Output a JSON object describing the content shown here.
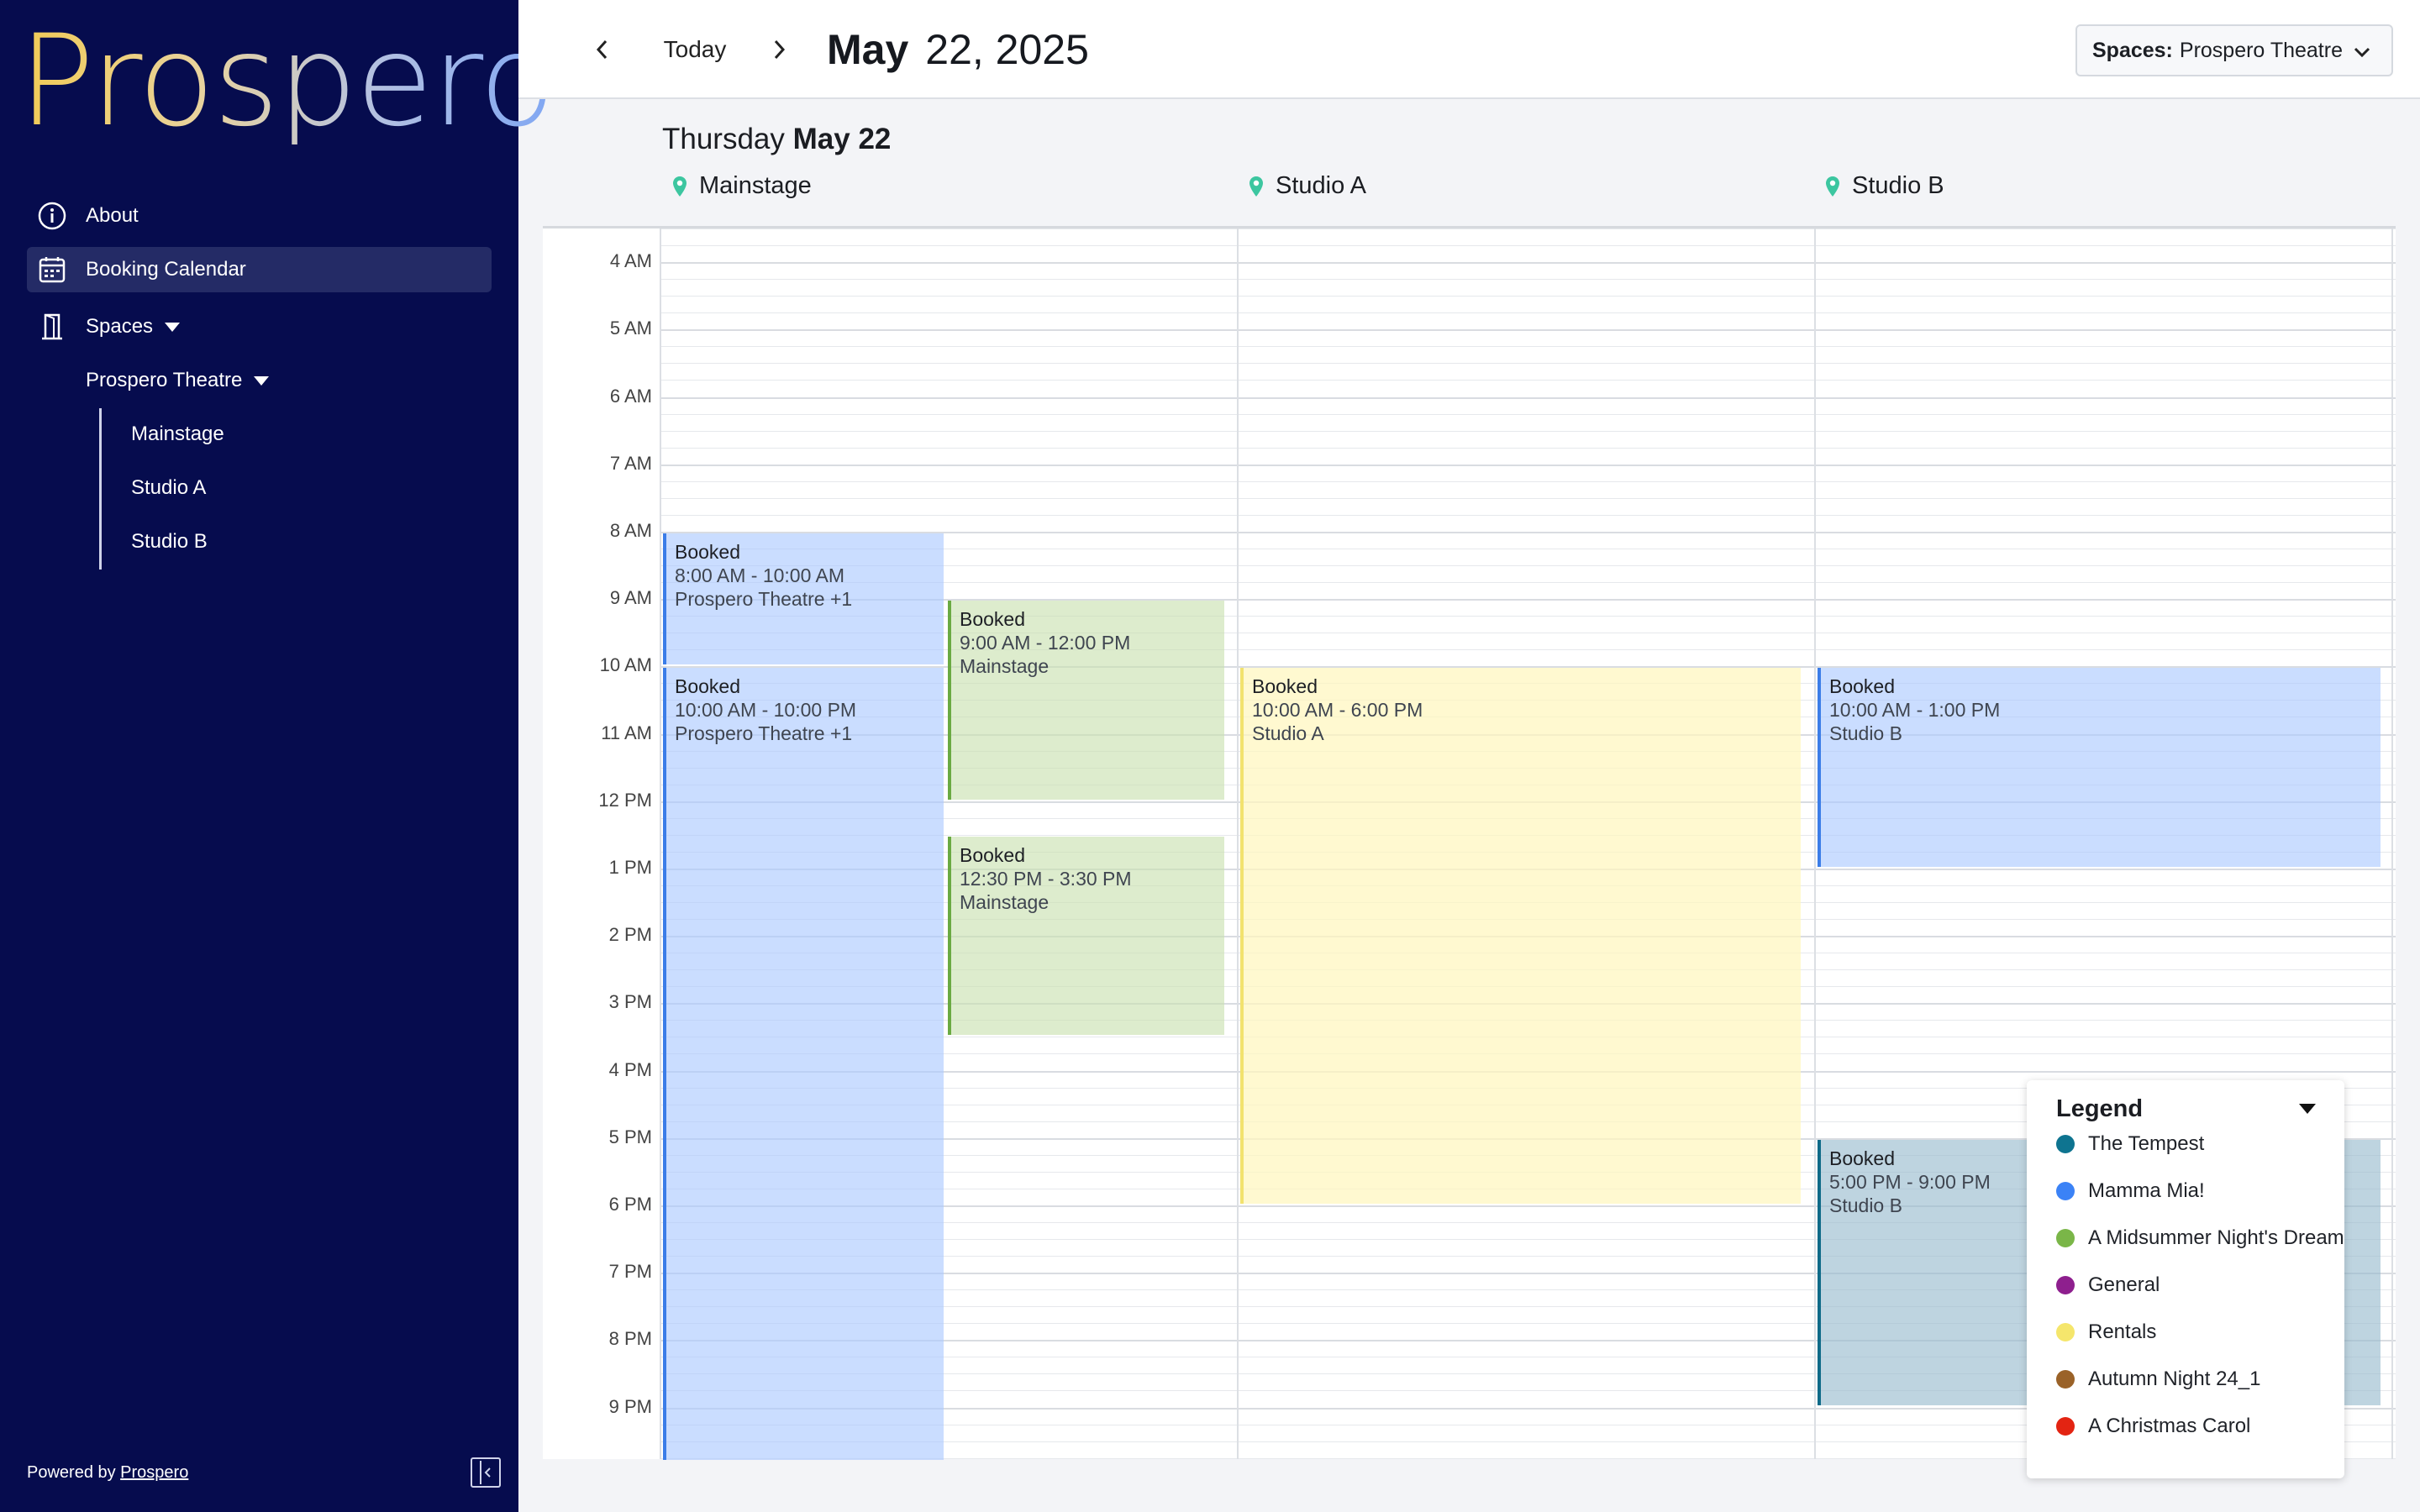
{
  "brand": {
    "logo_text": "Prospero"
  },
  "sidebar": {
    "items": [
      {
        "label": "About",
        "icon": "info-icon"
      },
      {
        "label": "Booking Calendar",
        "icon": "calendar-icon",
        "active": true
      },
      {
        "label": "Spaces",
        "icon": "door-icon"
      }
    ],
    "group": {
      "label": "Prospero Theatre"
    },
    "sub_items": [
      "Mainstage",
      "Studio A",
      "Studio B"
    ],
    "footer": {
      "prefix": "Powered by ",
      "link": "Prospero"
    }
  },
  "header": {
    "today_label": "Today",
    "month_day": "May",
    "day_year": "22, 2025",
    "spaces_label": "Spaces:",
    "spaces_value": "Prospero Theatre"
  },
  "day": {
    "weekday": "Thursday",
    "date": "May 22"
  },
  "columns": [
    "Mainstage",
    "Studio A",
    "Studio B"
  ],
  "time_labels": [
    "4 AM",
    "5 AM",
    "6 AM",
    "7 AM",
    "8 AM",
    "9 AM",
    "10 AM",
    "11 AM",
    "12 PM",
    "1 PM",
    "2 PM",
    "3 PM",
    "4 PM",
    "5 PM",
    "6 PM",
    "7 PM",
    "8 PM",
    "9 PM"
  ],
  "events": [
    {
      "title": "Booked",
      "time": "8:00 AM - 10:00 AM",
      "place": "Prospero Theatre +1",
      "column": 0,
      "lane": 0,
      "start": 8,
      "end": 10,
      "color": "blue"
    },
    {
      "title": "Booked",
      "time": "10:00 AM - 10:00 PM",
      "place": "Prospero Theatre +1",
      "column": 0,
      "lane": 0,
      "start": 10,
      "end": 22,
      "color": "blue"
    },
    {
      "title": "Booked",
      "time": "9:00 AM - 12:00 PM",
      "place": "Mainstage",
      "column": 0,
      "lane": 1,
      "start": 9,
      "end": 12,
      "color": "green"
    },
    {
      "title": "Booked",
      "time": "12:30 PM - 3:30 PM",
      "place": "Mainstage",
      "column": 0,
      "lane": 1,
      "start": 12.5,
      "end": 15.5,
      "color": "green"
    },
    {
      "title": "Booked",
      "time": "10:00 AM - 6:00 PM",
      "place": "Studio A",
      "column": 1,
      "lane": 0,
      "start": 10,
      "end": 18,
      "color": "yellow"
    },
    {
      "title": "Booked",
      "time": "10:00 AM - 1:00 PM",
      "place": "Studio B",
      "column": 2,
      "lane": 0,
      "start": 10,
      "end": 13,
      "color": "blue"
    },
    {
      "title": "Booked",
      "time": "5:00 PM - 9:00 PM",
      "place": "Studio B",
      "column": 2,
      "lane": 0,
      "start": 17,
      "end": 21,
      "color": "teal"
    }
  ],
  "legend": {
    "title": "Legend",
    "items": [
      {
        "label": "The Tempest",
        "color": "#0e7490"
      },
      {
        "label": "Mamma Mia!",
        "color": "#3b82f6"
      },
      {
        "label": "A Midsummer Night's Dream",
        "color": "#7ab648"
      },
      {
        "label": "General",
        "color": "#8e1f8e"
      },
      {
        "label": "Rentals",
        "color": "#f5e66c"
      },
      {
        "label": "Autumn Night 24_1",
        "color": "#9a6228"
      },
      {
        "label": "A Christmas Carol",
        "color": "#e32412"
      }
    ]
  },
  "colors": {
    "sidebar_bg": "#060c4e",
    "active_item_bg": "#242b66",
    "pin": "#3cc6a0"
  }
}
